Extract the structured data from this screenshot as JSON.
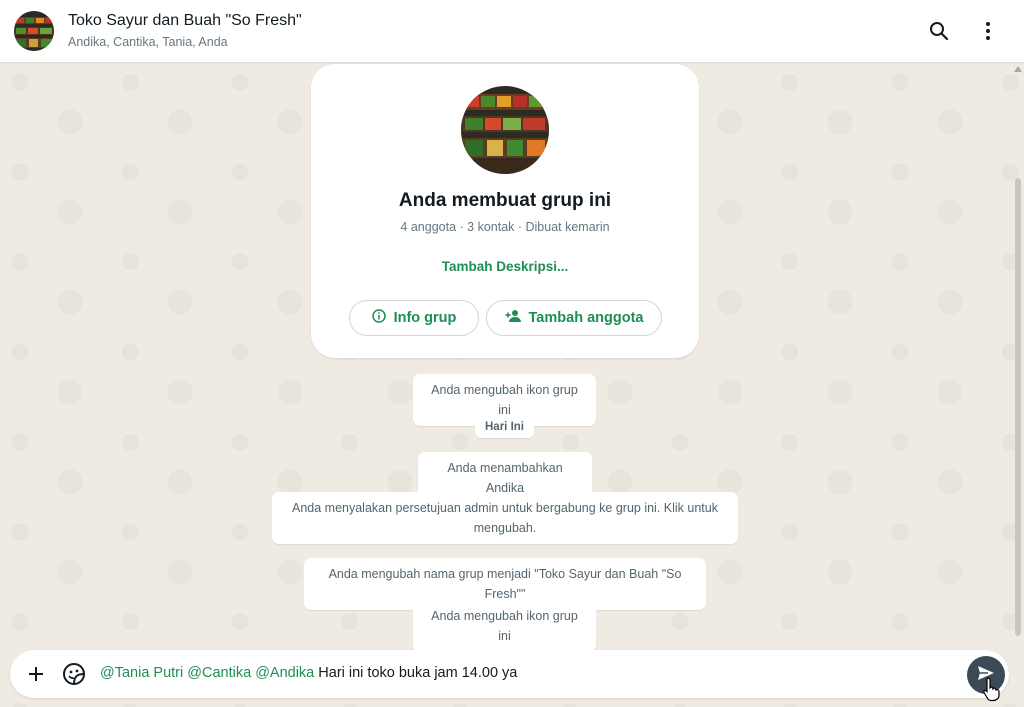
{
  "header": {
    "title": "Toko Sayur dan Buah \"So Fresh\"",
    "members": "Andika, Cantika, Tania, Anda",
    "icons": [
      "search-icon",
      "more-vert-icon"
    ]
  },
  "card": {
    "title": "Anda membuat grup ini",
    "meta": "4 anggota · 3 kontak · Dibuat kemarin",
    "add_description": "Tambah Deskripsi...",
    "info_button": "Info grup",
    "add_member_button": "Tambah anggota"
  },
  "messages": {
    "m1": "Anda mengubah ikon grup ini",
    "date": "Hari Ini",
    "m2": "Anda menambahkan Andika",
    "m3": "Anda menyalakan persetujuan admin untuk bergabung ke grup ini. Klik untuk mengubah.",
    "m4": "Anda mengubah nama grup menjadi \"Toko Sayur dan Buah \"So Fresh\"\"",
    "m5": "Anda mengubah ikon grup ini"
  },
  "composer": {
    "mention1": "@Tania Putri",
    "mention2": "@Cantika",
    "mention3": "@Andika",
    "text": "Hari ini toko buka jam 14.00 ya"
  },
  "colors": {
    "accent": "#1f8e55",
    "background": "#efeae2",
    "send": "#3b4a54"
  }
}
